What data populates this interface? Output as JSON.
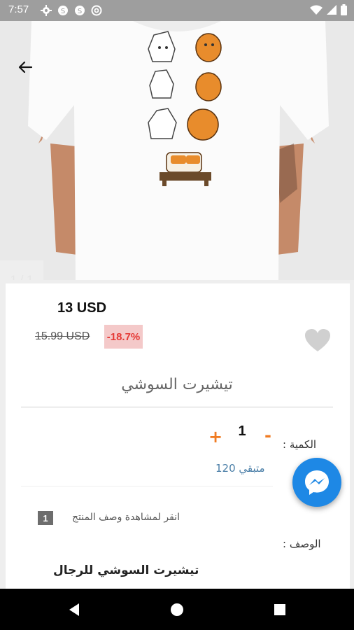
{
  "status_bar": {
    "time": "7:57",
    "left_icons": [
      "gear-icon",
      "notification-icon",
      "notification-icon",
      "at-sign-icon"
    ],
    "right_icons": [
      "wifi-icon",
      "signal-icon",
      "battery-icon"
    ]
  },
  "product_image": {
    "counter": "1 / 1"
  },
  "product": {
    "price": "13 USD",
    "old_price": "15.99 USD",
    "discount": "-18.7%",
    "title": "تيشيرت السوشي"
  },
  "quantity": {
    "label": "الكمية :",
    "value": "1",
    "plus": "+",
    "minus": "-",
    "stock": "متبقي 120"
  },
  "description": {
    "hint": "انقر لمشاهدة وصف المنتج",
    "badge": "1",
    "label": "الوصف :",
    "text": "تيشيرت السوشي للرجال"
  },
  "colors": {
    "accent": "#f07b22",
    "discount_text": "#e53935",
    "discount_bg": "#f4c9c9",
    "messenger": "#1e88e5",
    "stock_text": "#4b7fa8"
  }
}
